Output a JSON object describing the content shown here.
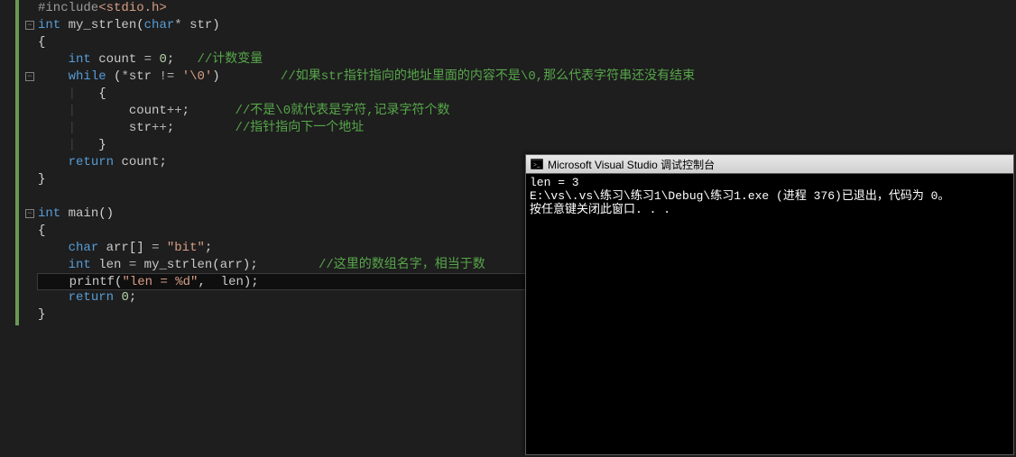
{
  "code": {
    "lines": [
      {
        "fold": false,
        "html": "<span class='pp'>#include</span><span class='inc'>&lt;stdio.h&gt;</span>"
      },
      {
        "fold": true,
        "html": "<span class='typ'>int</span> <span class='fn'>my_strlen</span><span class='pun'>(</span><span class='typ'>char</span><span class='op'>*</span> <span class='id'>str</span><span class='pun'>)</span>"
      },
      {
        "fold": false,
        "html": "<span class='pun'>{</span>"
      },
      {
        "fold": false,
        "html": "    <span class='typ'>int</span> <span class='id'>count</span> <span class='op'>=</span> <span class='num'>0</span><span class='pun'>;</span>   <span class='cmt'>//计数变量</span>"
      },
      {
        "fold": true,
        "html": "    <span class='kw'>while</span> <span class='pun'>(</span><span class='op'>*</span><span class='id'>str</span> <span class='op'>!=</span> <span class='str'>'\\0'</span><span class='pun'>)</span>        <span class='cmt'>//如果str指针指向的地址里面的内容不是\\0,那么代表字符串还没有结束</span>"
      },
      {
        "fold": false,
        "html": "    <span class='guide'>|</span>   <span class='pun'>{</span>"
      },
      {
        "fold": false,
        "html": "    <span class='guide'>|</span>       <span class='id'>count</span><span class='op'>++</span><span class='pun'>;</span>      <span class='cmt'>//不是\\0就代表是字符,记录字符个数</span>"
      },
      {
        "fold": false,
        "html": "    <span class='guide'>|</span>       <span class='id'>str</span><span class='op'>++</span><span class='pun'>;</span>        <span class='cmt'>//指针指向下一个地址</span>"
      },
      {
        "fold": false,
        "html": "    <span class='guide'>|</span>   <span class='pun'>}</span>"
      },
      {
        "fold": false,
        "html": "    <span class='kw'>return</span> <span class='id'>count</span><span class='pun'>;</span>"
      },
      {
        "fold": false,
        "html": "<span class='pun'>}</span>"
      },
      {
        "fold": false,
        "html": ""
      },
      {
        "fold": true,
        "html": "<span class='typ'>int</span> <span class='fn'>main</span><span class='pun'>()</span>"
      },
      {
        "fold": false,
        "html": "<span class='pun'>{</span>"
      },
      {
        "fold": false,
        "html": "    <span class='typ'>char</span> <span class='id'>arr</span><span class='pun'>[]</span> <span class='op'>=</span> <span class='str'>\"bit\"</span><span class='pun'>;</span>"
      },
      {
        "fold": false,
        "html": "    <span class='typ'>int</span> <span class='id'>len</span> <span class='op'>=</span> <span class='fn'>my_strlen</span><span class='pun'>(</span><span class='id'>arr</span><span class='pun'>);</span>        <span class='cmt'>//这里的数组名字，相当于数</span>"
      },
      {
        "fold": false,
        "current": true,
        "html": "    <span class='fn'>printf</span><span class='pun'>(</span><span class='str'>\"len = %d\"</span><span class='pun'>,</span>  <span class='id'>len</span><span class='pun'>);</span>"
      },
      {
        "fold": false,
        "html": "    <span class='kw'>return</span> <span class='num'>0</span><span class='pun'>;</span>"
      },
      {
        "fold": false,
        "html": "<span class='pun'>}</span>"
      }
    ]
  },
  "console": {
    "title": "Microsoft Visual Studio 调试控制台",
    "lines": [
      "len = 3",
      "E:\\vs\\.vs\\练习\\练习1\\Debug\\练习1.exe (进程 376)已退出，代码为 0。",
      "按任意键关闭此窗口. . ."
    ]
  }
}
